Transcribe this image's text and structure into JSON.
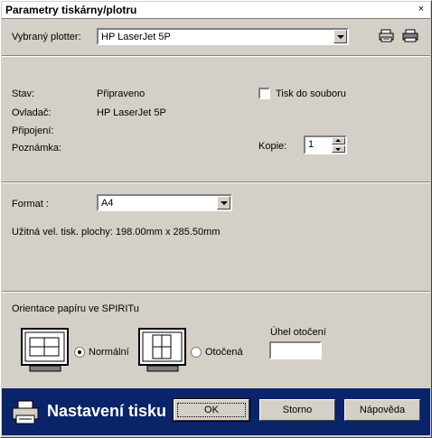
{
  "window": {
    "title": "Parametry tiskárny/plotru",
    "close": "×"
  },
  "plotter": {
    "label": "Vybraný plotter:",
    "value": "HP LaserJet 5P"
  },
  "toolbar_icons": [
    "printer-properties-icon",
    "printer-icon"
  ],
  "status": {
    "stav_label": "Stav:",
    "stav_value": "Připraveno",
    "ovladac_label": "Ovladač:",
    "ovladac_value": "HP LaserJet 5P",
    "pripojeni_label": "Připojení:",
    "pripojeni_value": "",
    "poznamka_label": "Poznámka:",
    "poznamka_value": ""
  },
  "print_to_file": {
    "label": "Tisk do souboru",
    "checked": false
  },
  "copies": {
    "label": "Kopie:",
    "value": "1"
  },
  "format": {
    "label": "Format :",
    "value": "A4",
    "usable_area": "Užitná vel. tisk. plochy: 198.00mm x 285.50mm"
  },
  "orientation": {
    "group_label": "Orientace papíru ve SPIRITu",
    "normal_label": "Normální",
    "rotated_label": "Otočená",
    "selected": "normal",
    "angle_label": "Úhel otočení",
    "angle_value": ""
  },
  "footer": {
    "title": "Nastavení tisku"
  },
  "buttons": {
    "ok": "OK",
    "cancel": "Storno",
    "help": "Nápověda"
  }
}
